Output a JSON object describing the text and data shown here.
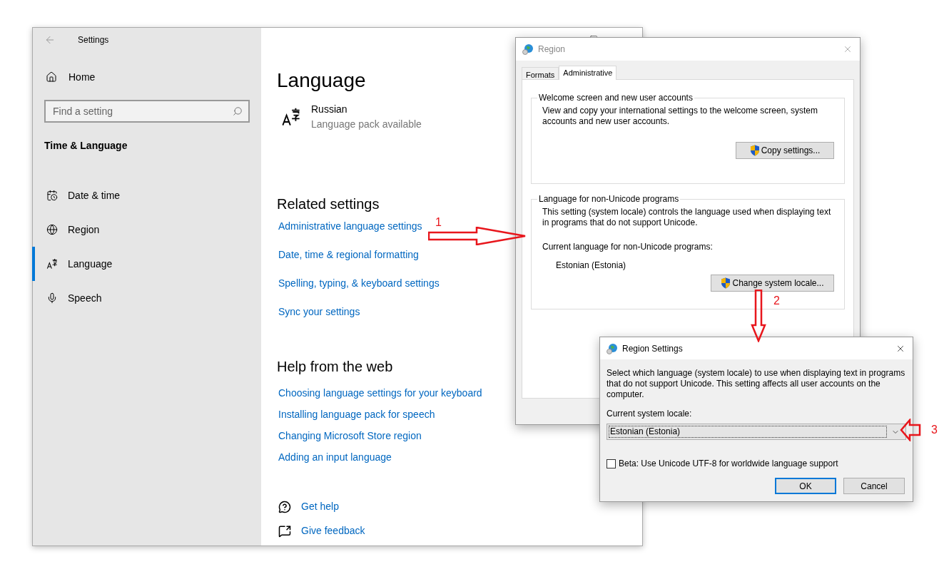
{
  "settings_window": {
    "title": "Settings",
    "sidebar": {
      "home": "Home",
      "search": {
        "placeholder": "Find a setting"
      },
      "section": "Time & Language",
      "items": [
        {
          "label": "Date & time",
          "selected": false
        },
        {
          "label": "Region",
          "selected": false
        },
        {
          "label": "Language",
          "selected": true
        },
        {
          "label": "Speech",
          "selected": false
        }
      ]
    },
    "content": {
      "heading": "Language",
      "language": {
        "name": "Russian",
        "status": "Language pack available"
      },
      "related_settings": {
        "heading": "Related settings",
        "links": [
          "Administrative language settings",
          "Date, time & regional formatting",
          "Spelling, typing, & keyboard settings",
          "Sync your settings"
        ]
      },
      "help": {
        "heading": "Help from the web",
        "links": [
          "Choosing language settings for your keyboard",
          "Installing language pack for speech",
          "Changing Microsoft Store region",
          "Adding an input language"
        ]
      },
      "footer_links": [
        {
          "label": "Get help",
          "kind": "help"
        },
        {
          "label": "Give feedback",
          "kind": "feedback"
        }
      ]
    }
  },
  "region_dialog": {
    "title": "Region",
    "tabs": [
      {
        "label": "Formats",
        "selected": false
      },
      {
        "label": "Administrative",
        "selected": true
      }
    ],
    "welcome_group": {
      "title": "Welcome screen and new user accounts",
      "text": "View and copy your international settings to the welcome screen, system accounts and new user accounts.",
      "button": "Copy settings..."
    },
    "non_unicode_group": {
      "title": "Language for non-Unicode programs",
      "text": "This setting (system locale) controls the language used when displaying text in programs that do not support Unicode.",
      "current_label": "Current language for non-Unicode programs:",
      "current_value": "Estonian (Estonia)",
      "button": "Change system locale..."
    }
  },
  "region_settings_dialog": {
    "title": "Region Settings",
    "description": "Select which language (system locale) to use when displaying text in programs that do not support Unicode. This setting affects all user accounts on the computer.",
    "locale_label": "Current system locale:",
    "locale_value": "Estonian (Estonia)",
    "checkbox": {
      "label": "Beta: Use Unicode UTF-8 for worldwide language support",
      "checked": false
    },
    "buttons": [
      {
        "label": "OK",
        "default": true
      },
      {
        "label": "Cancel",
        "default": false
      }
    ]
  },
  "annotations": [
    {
      "label": "1",
      "kind": "right"
    },
    {
      "label": "2",
      "kind": "down"
    },
    {
      "label": "3",
      "kind": "left"
    }
  ]
}
